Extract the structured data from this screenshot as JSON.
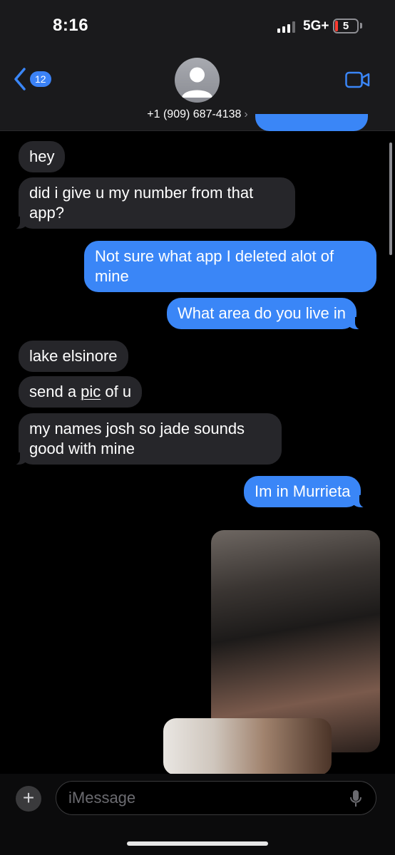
{
  "status_bar": {
    "time": "8:16",
    "network": "5G+",
    "battery": "5",
    "battery_color": "#ff3b30"
  },
  "header": {
    "back_badge": "12",
    "contact": "+1 (909) 687-4138",
    "contact_chevron": "›",
    "avatar_icon": "person-silhouette-icon",
    "video_icon": "video-camera-icon",
    "accent_color": "#3a86f7"
  },
  "messages": [
    {
      "side": "received",
      "text": "hey"
    },
    {
      "side": "received",
      "lines": [
        "did i give u my number from that",
        "app?"
      ]
    },
    {
      "side": "sent",
      "lines": [
        "Not sure what app I deleted alot of",
        "mine"
      ]
    },
    {
      "side": "sent",
      "text": "What area do you live in"
    },
    {
      "side": "received",
      "text": "lake elsinore"
    },
    {
      "side": "received",
      "parts": [
        "send a ",
        "pic",
        " of u"
      ]
    },
    {
      "side": "received",
      "lines": [
        "my names josh so jade sounds",
        "good with mine"
      ]
    },
    {
      "side": "sent",
      "text": "Im in Murrieta"
    },
    {
      "side": "sent",
      "type": "photo"
    },
    {
      "side": "sent",
      "type": "photo"
    }
  ],
  "composer": {
    "placeholder": "iMessage",
    "add_label": "+",
    "mic_icon": "microphone-icon"
  }
}
